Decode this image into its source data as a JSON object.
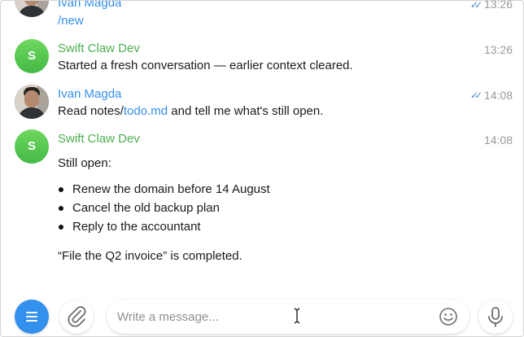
{
  "messages": [
    {
      "sender": "Ivan Magda",
      "text": "/new",
      "time": "13:26",
      "read": true
    },
    {
      "sender": "Swift Claw Dev",
      "avatar_initial": "S",
      "text": "Started a fresh conversation — earlier context cleared.",
      "time": "13:26"
    },
    {
      "sender": "Ivan Magda",
      "text_prefix": "Read notes/",
      "text_link": "todo.md",
      "text_suffix": " and tell me what's still open.",
      "time": "14:08",
      "read": true
    },
    {
      "sender": "Swift Claw Dev",
      "avatar_initial": "S",
      "time": "14:08",
      "intro": "Still open:",
      "items": [
        "Renew the domain before 14 August",
        "Cancel the old backup plan",
        "Reply to the accountant"
      ],
      "outro": "“File the Q2 invoice” is completed."
    }
  ],
  "composer": {
    "placeholder": "Write a message..."
  },
  "colors": {
    "accent": "#3390ec",
    "bot_name": "#4caf50",
    "read_checks": "#4a8bd6",
    "time": "#9a9a9a"
  },
  "icons": [
    "menu-icon",
    "paperclip-icon",
    "emoji-icon",
    "microphone-icon",
    "double-check-icon"
  ]
}
